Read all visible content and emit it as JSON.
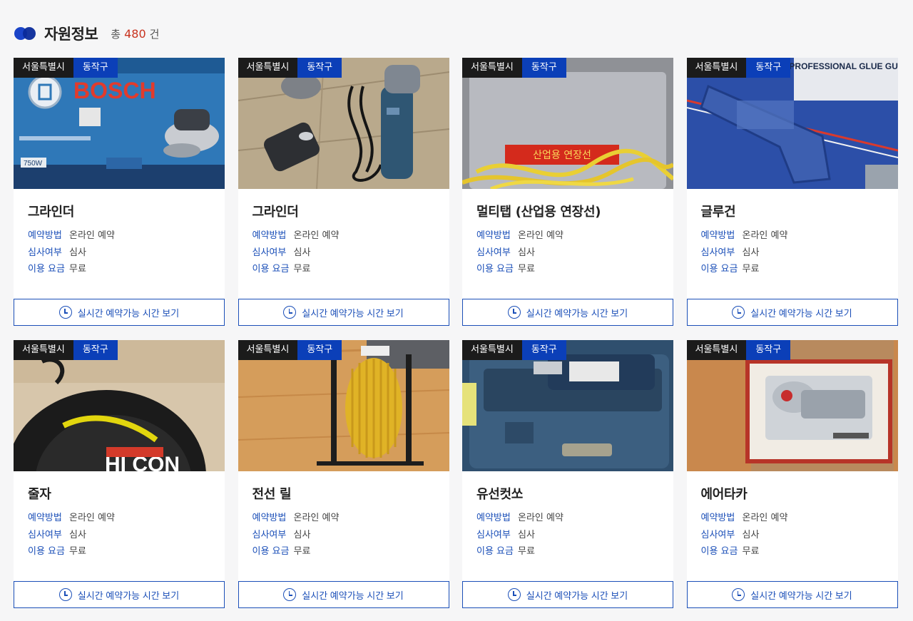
{
  "header": {
    "title": "자원정보",
    "total_prefix": "총",
    "total_count": "480",
    "total_suffix": "건"
  },
  "labels": {
    "method": "예약방법",
    "review": "심사여부",
    "fee": "이용 요금",
    "button": "실시간 예약가능 시간 보기"
  },
  "cards": [
    {
      "city": "서울특별시",
      "district": "동작구",
      "name": "그라인더",
      "method": "온라인 예약",
      "review": "심사",
      "fee": "무료",
      "image_label": "BOSCH",
      "watt_label": "750W"
    },
    {
      "city": "서울특별시",
      "district": "동작구",
      "name": "그라인더",
      "method": "온라인 예약",
      "review": "심사",
      "fee": "무료"
    },
    {
      "city": "서울특별시",
      "district": "동작구",
      "name": "멀티탭 (산업용 연장선)",
      "method": "온라인 예약",
      "review": "심사",
      "fee": "무료",
      "image_label": "산업용 연장선"
    },
    {
      "city": "서울특별시",
      "district": "동작구",
      "name": "글루건",
      "method": "온라인 예약",
      "review": "심사",
      "fee": "무료",
      "image_label": "PROFESSIONAL GLUE GUN"
    },
    {
      "city": "서울특별시",
      "district": "동작구",
      "name": "줄자",
      "method": "온라인 예약",
      "review": "심사",
      "fee": "무료",
      "image_label": "HI CON"
    },
    {
      "city": "서울특별시",
      "district": "동작구",
      "name": "전선 릴",
      "method": "온라인 예약",
      "review": "심사",
      "fee": "무료"
    },
    {
      "city": "서울특별시",
      "district": "동작구",
      "name": "유선컷쏘",
      "method": "온라인 예약",
      "review": "심사",
      "fee": "무료"
    },
    {
      "city": "서울특별시",
      "district": "동작구",
      "name": "에어타카",
      "method": "온라인 예약",
      "review": "심사",
      "fee": "무료"
    }
  ],
  "colors": {
    "accent_blue": "#1b4fb8",
    "district_tag": "#0b3fb8",
    "city_tag": "#1b1b1b",
    "count_red": "#c8331f"
  }
}
